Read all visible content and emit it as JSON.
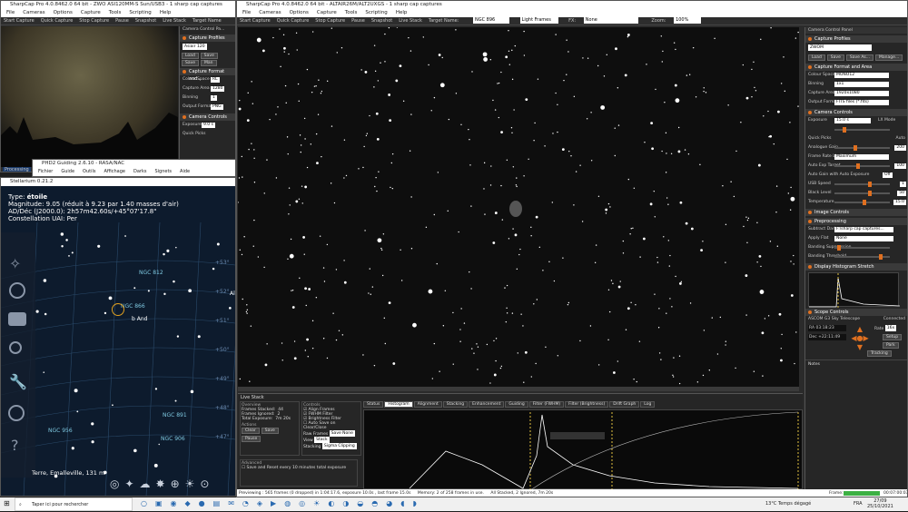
{
  "small_win": {
    "title": "SharpCap Pro 4.0.8462.0 64 bit - ZWO ASI120MM-S Sun/USB3 - 1 sharp cap captures",
    "menu": [
      "File",
      "Cameras",
      "Options",
      "Capture",
      "Tools",
      "Scripting",
      "Help"
    ],
    "toolbar": [
      "Start Capture",
      "Quick Capture",
      "Stop Capture",
      "Pause",
      "Snapshot",
      "Live Stack",
      "Target Name"
    ],
    "panel_title": "Camera Control Pa...",
    "sec_profiles": "Capture Profiles",
    "profile_value": "Asiair 120",
    "profile_buttons": [
      "Load",
      "Save",
      "Save",
      "Man"
    ],
    "sec_format": "Capture Format and...",
    "rows": [
      {
        "k": "Colour Space",
        "v": "RL"
      },
      {
        "k": "Capture Area",
        "v": "1280"
      },
      {
        "k": "Binning",
        "v": "1"
      },
      {
        "k": "Output Format",
        "v": "PNG"
      }
    ],
    "sec_camera": "Camera Controls",
    "exposure_label": "Exposure",
    "exposure_value": "9.0 s",
    "lx_mode": "LX Mode",
    "quick_picks": "Quick Picks",
    "processing": "Processing"
  },
  "phd": {
    "title": "PHD2 Guiding 2.6.10 - RASA/NAC",
    "menu": [
      "Fichier",
      "Guide",
      "Outils",
      "Affichage",
      "Darks",
      "Signets",
      "Aide"
    ]
  },
  "stellarium": {
    "title": "Stellarium 0.21.2",
    "info": {
      "type_label": "Type: ",
      "type": "étoile",
      "mag": "Magnitude: 9.05 (réduit à 9.23 par 1.40 masses d'air)",
      "coords": "AD/Déc (J2000.0): 2h57m42.60s/+45°07'17.8\"",
      "const": "Constellation UAI: Per"
    },
    "labels": [
      "NGC 812",
      "NGC 956",
      "NGC 891",
      "NGC 906",
      "NGC 866",
      "b And",
      "Al"
    ],
    "decl": [
      "+53°",
      "+52°",
      "+51°",
      "+50°",
      "+49°",
      "+48°",
      "+47°"
    ],
    "location": "Terre, Emalleville, 131 m"
  },
  "main_win": {
    "title": "SharpCap Pro 4.0.8462.0 64 bit - ALTAIR26M/ALT2UXGS - 1 sharp cap captures",
    "menu": [
      "File",
      "Cameras",
      "Options",
      "Capture",
      "Tools",
      "Scripting",
      "Help"
    ],
    "toolbar": {
      "items": [
        "Start Capture",
        "Quick Capture",
        "Stop Capture",
        "Pause",
        "Snapshot",
        "Live Stack",
        "Target Name:"
      ],
      "target": "NGC 896",
      "frames": "Light Frames",
      "fx_label": "FX:",
      "fx": "None",
      "zoom_label": "Zoom:",
      "zoom": "100%"
    }
  },
  "ccp": {
    "title": "Camera Control Panel",
    "sec_profiles": "Capture Profiles",
    "profile_value": "ZWOM",
    "profile_buttons": [
      "Load",
      "Save",
      "Save As...",
      "Manage..."
    ],
    "sec_format": "Capture Format and Area",
    "format_rows": [
      {
        "k": "Colour Space",
        "v": "MONO12"
      },
      {
        "k": "Binning",
        "v": "1x1"
      },
      {
        "k": "Capture Area",
        "v": "1920x1080"
      },
      {
        "k": "Output Format",
        "v": "FITS files (*.fits)"
      }
    ],
    "sec_camera": "Camera Controls",
    "exposure_label": "Exposure",
    "exposure_value": "15.0 s",
    "lx": "LX Mode",
    "quick_picks": "Quick Picks",
    "auto": "Auto",
    "analogue_gain_label": "Analogue Gain",
    "analogue_gain": "200",
    "frame_rate_label": "Frame Rate Limit",
    "frame_rate": "Maximum",
    "auto_exp_label": "Auto Exp Target",
    "auto_exp": "100",
    "auto_gain_label": "Auto Gain with Auto Exposure",
    "auto_gain": "Off",
    "usb_label": "USB Speed",
    "usb": "1",
    "black_label": "Black Level",
    "black": "50",
    "temp_label": "Temperature",
    "temp": "15.0",
    "sec_image": "Image Controls",
    "sec_pre": "Preprocessing",
    "subtract_label": "Subtract Dark",
    "subtract": "F:\\sharp cap captures...",
    "flat_label": "Apply Flat",
    "flat": "None",
    "banding_sup": "Banding Suppression",
    "banding_thr": "Banding Threshold",
    "sec_hist": "Display Histogram Stretch",
    "sec_scope": "Scope Controls",
    "scope_name": "ASCOM G3 Sky Telescope",
    "connected": "Connected",
    "ra_label": "RA",
    "ra": "03:18:23",
    "dec_label": "Dec",
    "dec": "+22:11:49",
    "rate_label": "Rate",
    "rate": "16x",
    "setup": "Setup",
    "park": "Park",
    "tracking": "Tracking",
    "notes": "Notes"
  },
  "livestack": {
    "title": "Live Stack",
    "overview": "Overview",
    "stats": [
      {
        "k": "Frames Stacked:",
        "v": "44"
      },
      {
        "k": "Frames Ignored:",
        "v": "2"
      },
      {
        "k": "Total Exposure:",
        "v": "7m 20s"
      }
    ],
    "actions": "Actions",
    "buttons": [
      "Clear",
      "Save",
      "Pause"
    ],
    "advanced": "Advanced",
    "save_reset": "Save and Reset every",
    "minutes": "10 minutes total exposure",
    "controls": "Controls",
    "checks": [
      "Align Frames",
      "FWHM Filter",
      "Brightness Filter",
      "Auto Save on Clear/Close"
    ],
    "raw_frames_label": "Raw Frames",
    "raw_frames": "Save None",
    "view_label": "View",
    "view": "Stack",
    "stacking_label": "Stacking",
    "stacking": "Sigma Clipping",
    "tabs": [
      "Status",
      "Histogram",
      "Alignment",
      "Stacking",
      "Enhancement",
      "Guiding",
      "Filter (FWHM)",
      "Filter (Brightness)",
      "Drift Graph",
      "Log"
    ]
  },
  "status": {
    "left": "Previewing : 565 frames (0 dropped) in 1:04:17.6, exposure 10.0s , last frame 15.0s",
    "memory": "Memory: 2 of 258 frames in use.",
    "stack": "All Stacked, 2 Ignored, 7m 20s",
    "frame_label": "Frame:",
    "frame_num": "00:07:00:03"
  },
  "taskbar": {
    "search": "Taper ici pour rechercher",
    "weather": "13°C Temps dégagé",
    "lang": "FRA",
    "time": "27/09",
    "date": "25/10/2021"
  }
}
